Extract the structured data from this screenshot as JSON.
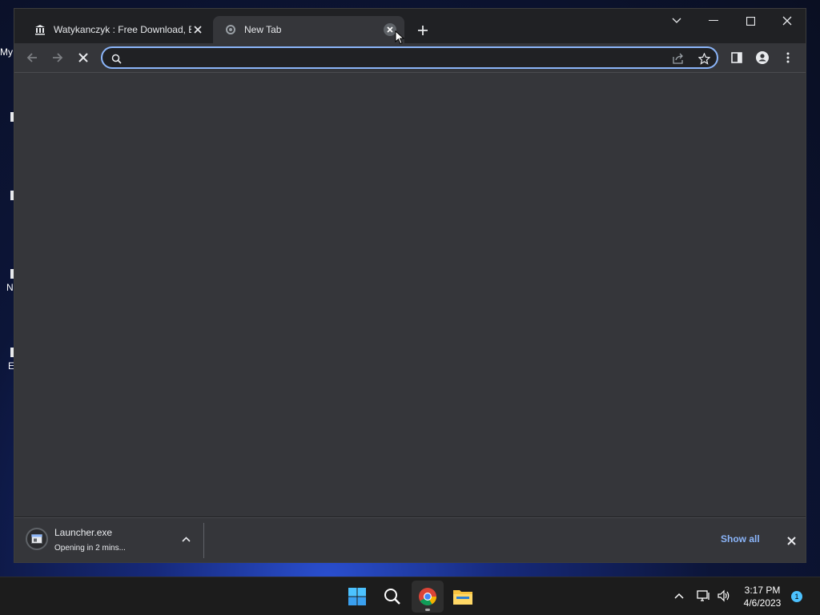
{
  "desktop": {
    "labels": [
      "My",
      "N",
      "E"
    ]
  },
  "browser": {
    "tabs": [
      {
        "title": "Watykanczyk : Free Download, Bo",
        "favicon": "archive-icon",
        "active": false
      },
      {
        "title": "New Tab",
        "favicon": "chrome-icon",
        "active": true
      }
    ],
    "omnibox": {
      "value": "",
      "placeholder": ""
    },
    "accent_color": "#8ab4f8"
  },
  "downloads": {
    "filename": "Launcher.exe",
    "status": "Opening in 2 mins...",
    "show_all_label": "Show all"
  },
  "taskbar": {
    "time": "3:17 PM",
    "date": "4/6/2023",
    "notification_count": "1"
  }
}
